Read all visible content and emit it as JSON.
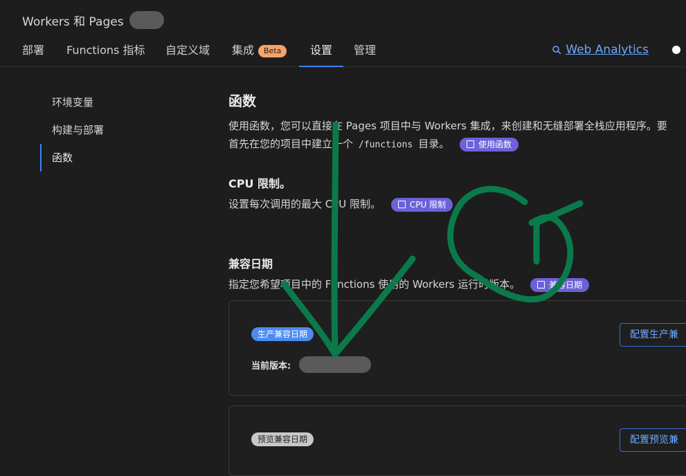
{
  "app": {
    "title": "Workers 和 Pages"
  },
  "tabs": [
    {
      "label": "部署"
    },
    {
      "label": "Functions 指标"
    },
    {
      "label": "自定义域"
    },
    {
      "label": "集成",
      "badge": "Beta"
    },
    {
      "label": "设置"
    },
    {
      "label": "管理"
    }
  ],
  "header_right": {
    "analytics_label": "Web Analytics"
  },
  "sidebar": {
    "items": [
      {
        "label": "环境变量"
      },
      {
        "label": "构建与部署"
      },
      {
        "label": "函数"
      }
    ]
  },
  "functions": {
    "title": "函数",
    "desc_line1": "使用函数，您可以直接在 Pages 项目中与 Workers 集成，来创建和无缝部署全栈应用程序。要",
    "desc_line2_pre": "首先在您的项目中建立一个",
    "desc_code": "/functions",
    "desc_line2_post": "目录。",
    "link_label": "使用函数"
  },
  "cpu": {
    "title": "CPU 限制。",
    "desc": "设置每次调用的最大 CPU 限制。",
    "link_label": "CPU 限制"
  },
  "compat": {
    "title": "兼容日期",
    "desc": "指定您希望项目中的 Functions 使用的 Workers 运行时版本。",
    "link_label": "兼容日期",
    "production": {
      "tag": "生产兼容日期",
      "version_label": "当前版本:",
      "button_label": "配置生产兼"
    },
    "preview": {
      "tag": "预览兼容日期",
      "button_label": "配置预览兼"
    }
  },
  "colors": {
    "accent": "#3b82f6",
    "annotation": "#0b7a4b",
    "doc_pill": "#6b62d9",
    "beta": "#f6a36b"
  }
}
